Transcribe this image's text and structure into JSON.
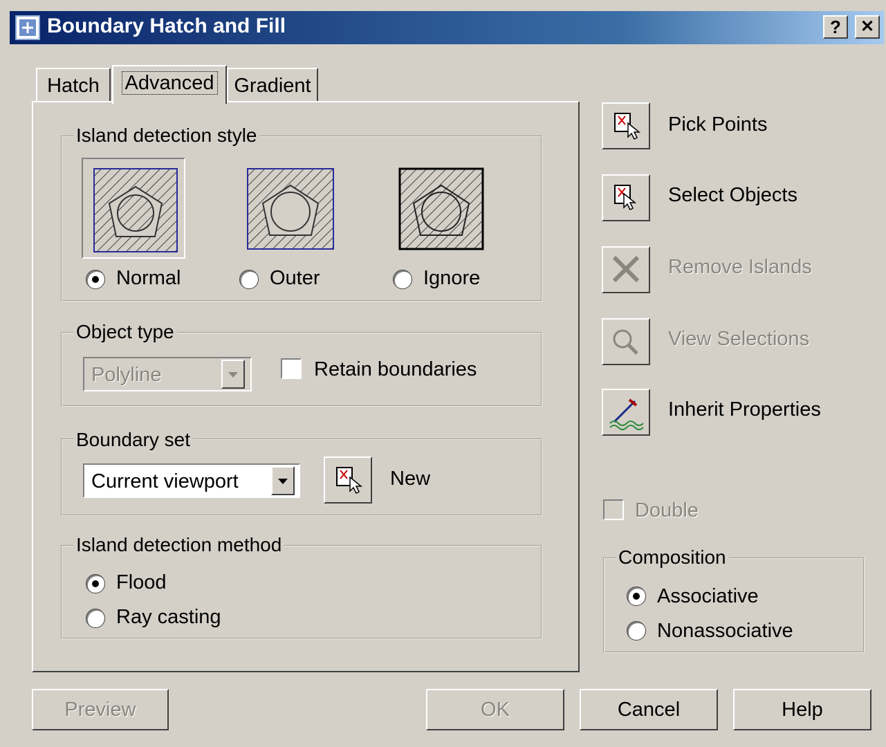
{
  "window": {
    "title": "Boundary Hatch and Fill",
    "help_button": "?",
    "close_button": "✕"
  },
  "tabs": [
    {
      "label": "Hatch"
    },
    {
      "label": "Advanced",
      "selected": true
    },
    {
      "label": "Gradient"
    }
  ],
  "island_style": {
    "legend": "Island detection style",
    "options": [
      {
        "label": "Normal",
        "selected": true
      },
      {
        "label": "Outer",
        "selected": false
      },
      {
        "label": "Ignore",
        "selected": false
      }
    ]
  },
  "object_type": {
    "legend": "Object type",
    "value": "Polyline",
    "retain_label": "Retain boundaries",
    "retain_checked": false
  },
  "boundary_set": {
    "legend": "Boundary set",
    "value": "Current viewport",
    "new_label": "New"
  },
  "island_method": {
    "legend": "Island detection method",
    "options": [
      {
        "label": "Flood",
        "selected": true
      },
      {
        "label": "Ray casting",
        "selected": false
      }
    ]
  },
  "actions": [
    {
      "label": "Pick Points",
      "icon": "pick-points-icon",
      "enabled": true
    },
    {
      "label": "Select Objects",
      "icon": "select-objects-icon",
      "enabled": true
    },
    {
      "label": "Remove Islands",
      "icon": "remove-islands-icon",
      "enabled": false
    },
    {
      "label": "View Selections",
      "icon": "view-selections-icon",
      "enabled": false
    },
    {
      "label": "Inherit Properties",
      "icon": "inherit-properties-icon",
      "enabled": true
    }
  ],
  "double": {
    "label": "Double",
    "enabled": false,
    "checked": false
  },
  "composition": {
    "legend": "Composition",
    "options": [
      {
        "label": "Associative",
        "selected": true
      },
      {
        "label": "Nonassociative",
        "selected": false
      }
    ]
  },
  "footer": {
    "preview": "Preview",
    "ok": "OK",
    "cancel": "Cancel",
    "help": "Help"
  },
  "colors": {
    "face": "#d4d0c8",
    "title_start": "#0a246a",
    "title_end": "#a6caf0",
    "disabled_text": "#8a8780"
  }
}
